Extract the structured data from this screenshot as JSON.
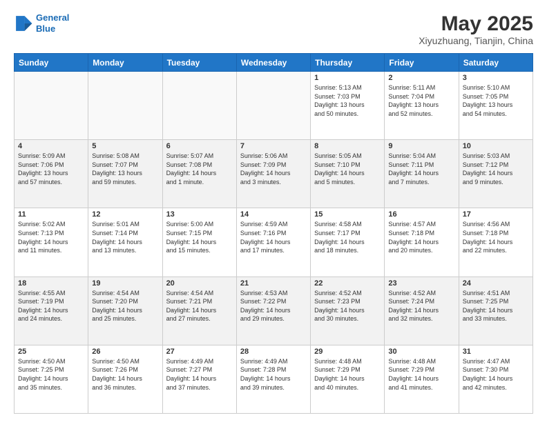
{
  "logo": {
    "line1": "General",
    "line2": "Blue"
  },
  "title": "May 2025",
  "subtitle": "Xiyuzhuang, Tianjin, China",
  "days": [
    "Sunday",
    "Monday",
    "Tuesday",
    "Wednesday",
    "Thursday",
    "Friday",
    "Saturday"
  ],
  "weeks": [
    [
      {
        "day": "",
        "info": ""
      },
      {
        "day": "",
        "info": ""
      },
      {
        "day": "",
        "info": ""
      },
      {
        "day": "",
        "info": ""
      },
      {
        "day": "1",
        "info": "Sunrise: 5:13 AM\nSunset: 7:03 PM\nDaylight: 13 hours\nand 50 minutes."
      },
      {
        "day": "2",
        "info": "Sunrise: 5:11 AM\nSunset: 7:04 PM\nDaylight: 13 hours\nand 52 minutes."
      },
      {
        "day": "3",
        "info": "Sunrise: 5:10 AM\nSunset: 7:05 PM\nDaylight: 13 hours\nand 54 minutes."
      }
    ],
    [
      {
        "day": "4",
        "info": "Sunrise: 5:09 AM\nSunset: 7:06 PM\nDaylight: 13 hours\nand 57 minutes."
      },
      {
        "day": "5",
        "info": "Sunrise: 5:08 AM\nSunset: 7:07 PM\nDaylight: 13 hours\nand 59 minutes."
      },
      {
        "day": "6",
        "info": "Sunrise: 5:07 AM\nSunset: 7:08 PM\nDaylight: 14 hours\nand 1 minute."
      },
      {
        "day": "7",
        "info": "Sunrise: 5:06 AM\nSunset: 7:09 PM\nDaylight: 14 hours\nand 3 minutes."
      },
      {
        "day": "8",
        "info": "Sunrise: 5:05 AM\nSunset: 7:10 PM\nDaylight: 14 hours\nand 5 minutes."
      },
      {
        "day": "9",
        "info": "Sunrise: 5:04 AM\nSunset: 7:11 PM\nDaylight: 14 hours\nand 7 minutes."
      },
      {
        "day": "10",
        "info": "Sunrise: 5:03 AM\nSunset: 7:12 PM\nDaylight: 14 hours\nand 9 minutes."
      }
    ],
    [
      {
        "day": "11",
        "info": "Sunrise: 5:02 AM\nSunset: 7:13 PM\nDaylight: 14 hours\nand 11 minutes."
      },
      {
        "day": "12",
        "info": "Sunrise: 5:01 AM\nSunset: 7:14 PM\nDaylight: 14 hours\nand 13 minutes."
      },
      {
        "day": "13",
        "info": "Sunrise: 5:00 AM\nSunset: 7:15 PM\nDaylight: 14 hours\nand 15 minutes."
      },
      {
        "day": "14",
        "info": "Sunrise: 4:59 AM\nSunset: 7:16 PM\nDaylight: 14 hours\nand 17 minutes."
      },
      {
        "day": "15",
        "info": "Sunrise: 4:58 AM\nSunset: 7:17 PM\nDaylight: 14 hours\nand 18 minutes."
      },
      {
        "day": "16",
        "info": "Sunrise: 4:57 AM\nSunset: 7:18 PM\nDaylight: 14 hours\nand 20 minutes."
      },
      {
        "day": "17",
        "info": "Sunrise: 4:56 AM\nSunset: 7:18 PM\nDaylight: 14 hours\nand 22 minutes."
      }
    ],
    [
      {
        "day": "18",
        "info": "Sunrise: 4:55 AM\nSunset: 7:19 PM\nDaylight: 14 hours\nand 24 minutes."
      },
      {
        "day": "19",
        "info": "Sunrise: 4:54 AM\nSunset: 7:20 PM\nDaylight: 14 hours\nand 25 minutes."
      },
      {
        "day": "20",
        "info": "Sunrise: 4:54 AM\nSunset: 7:21 PM\nDaylight: 14 hours\nand 27 minutes."
      },
      {
        "day": "21",
        "info": "Sunrise: 4:53 AM\nSunset: 7:22 PM\nDaylight: 14 hours\nand 29 minutes."
      },
      {
        "day": "22",
        "info": "Sunrise: 4:52 AM\nSunset: 7:23 PM\nDaylight: 14 hours\nand 30 minutes."
      },
      {
        "day": "23",
        "info": "Sunrise: 4:52 AM\nSunset: 7:24 PM\nDaylight: 14 hours\nand 32 minutes."
      },
      {
        "day": "24",
        "info": "Sunrise: 4:51 AM\nSunset: 7:25 PM\nDaylight: 14 hours\nand 33 minutes."
      }
    ],
    [
      {
        "day": "25",
        "info": "Sunrise: 4:50 AM\nSunset: 7:25 PM\nDaylight: 14 hours\nand 35 minutes."
      },
      {
        "day": "26",
        "info": "Sunrise: 4:50 AM\nSunset: 7:26 PM\nDaylight: 14 hours\nand 36 minutes."
      },
      {
        "day": "27",
        "info": "Sunrise: 4:49 AM\nSunset: 7:27 PM\nDaylight: 14 hours\nand 37 minutes."
      },
      {
        "day": "28",
        "info": "Sunrise: 4:49 AM\nSunset: 7:28 PM\nDaylight: 14 hours\nand 39 minutes."
      },
      {
        "day": "29",
        "info": "Sunrise: 4:48 AM\nSunset: 7:29 PM\nDaylight: 14 hours\nand 40 minutes."
      },
      {
        "day": "30",
        "info": "Sunrise: 4:48 AM\nSunset: 7:29 PM\nDaylight: 14 hours\nand 41 minutes."
      },
      {
        "day": "31",
        "info": "Sunrise: 4:47 AM\nSunset: 7:30 PM\nDaylight: 14 hours\nand 42 minutes."
      }
    ]
  ]
}
